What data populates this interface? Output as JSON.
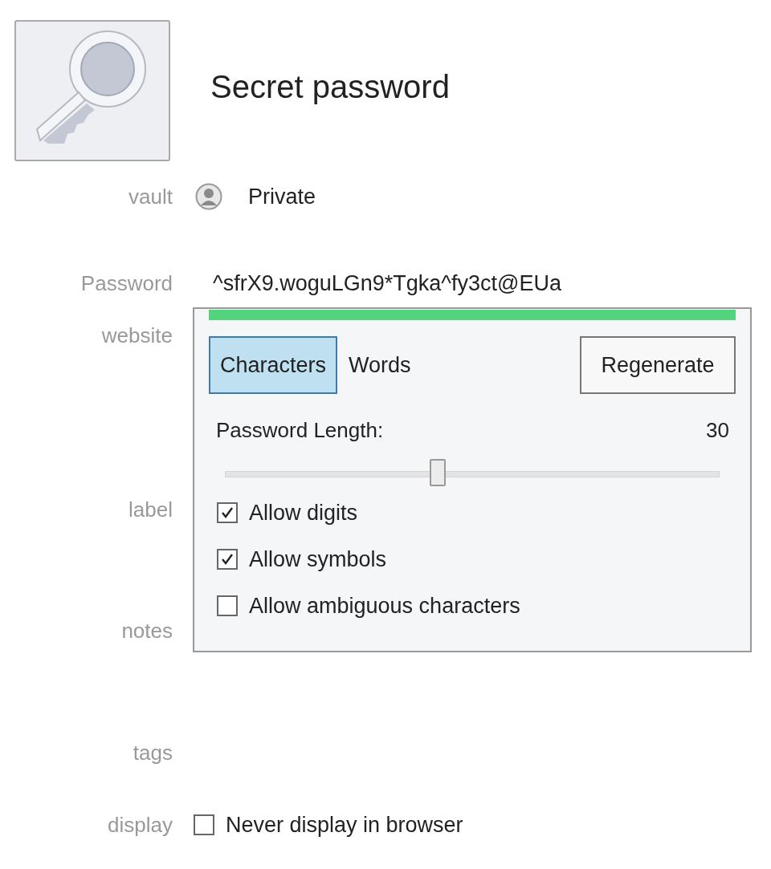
{
  "header": {
    "title": "Secret password"
  },
  "fields": [
    {
      "label": "vault",
      "kind": "vault",
      "value": "Private"
    },
    {
      "label": "Password",
      "kind": "password",
      "value": "^sfrX9.woguLGn9*Tgka^fy3ct@EUa"
    },
    {
      "label": "website",
      "kind": "empty"
    },
    {
      "label": "label",
      "kind": "empty"
    },
    {
      "label": "notes",
      "kind": "empty"
    },
    {
      "label": "tags",
      "kind": "empty"
    },
    {
      "label": "display",
      "kind": "checkbox",
      "option": {
        "label": "Never display in browser",
        "checked": false
      }
    }
  ],
  "generator": {
    "modes": [
      {
        "label": "Characters",
        "selected": true
      },
      {
        "label": "Words",
        "selected": false
      }
    ],
    "regenerate_button": "Regenerate",
    "length_label": "Password Length:",
    "length_value": "30",
    "slider": {
      "level": 0.43
    },
    "options": [
      {
        "label": "Allow digits",
        "checked": true
      },
      {
        "label": "Allow symbols",
        "checked": true
      },
      {
        "label": "Allow ambiguous characters",
        "checked": false
      }
    ]
  }
}
